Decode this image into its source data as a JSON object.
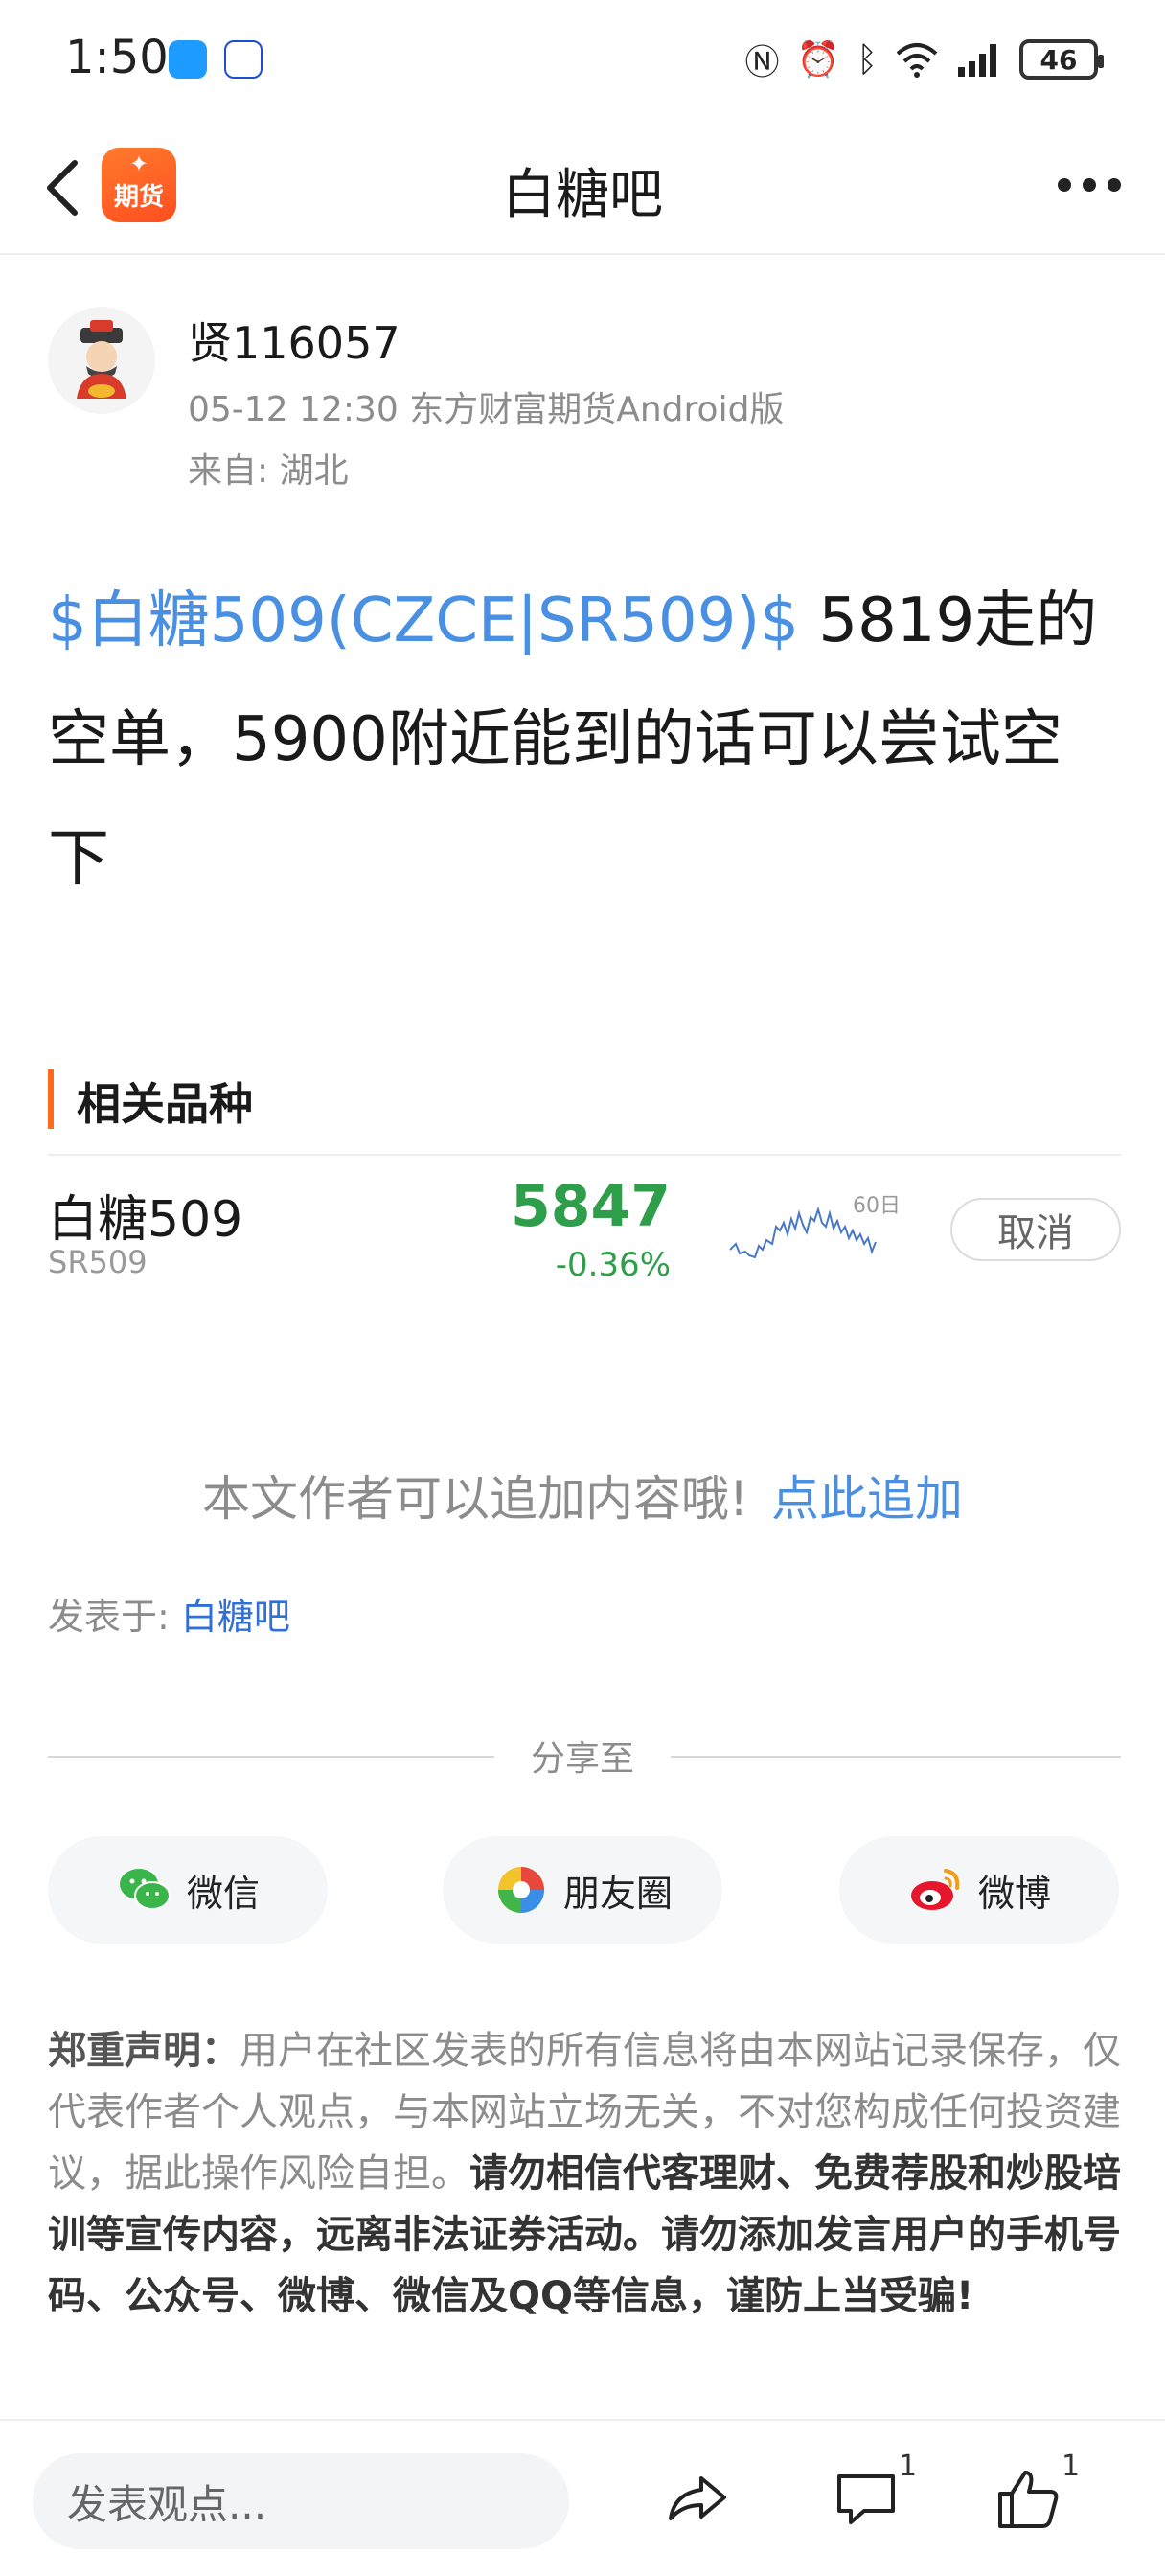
{
  "status_bar": {
    "time": "1:50",
    "battery": "46"
  },
  "header": {
    "title": "白糖吧",
    "logo_text": "期货"
  },
  "post": {
    "author_name": "贤116057",
    "meta": "05-12 12:30 东方财富期货Android版",
    "location": "来自: 湖北",
    "stock_link": "$白糖509(CZCE|SR509)$",
    "body_text": " 5819走的空单，5900附近能到的话可以尝试空下"
  },
  "related": {
    "title": "相关品种",
    "name": "白糖509",
    "code": "SR509",
    "price": "5847",
    "change": "-0.36%",
    "spark_label": "60日",
    "cancel_label": "取消",
    "price_color": "#2e9e4a"
  },
  "append": {
    "text": "本文作者可以追加内容哦!",
    "link": "点此追加"
  },
  "posted_in": {
    "label": "发表于: ",
    "bar": "白糖吧"
  },
  "share": {
    "label": "分享至",
    "wechat": "微信",
    "moments": "朋友圈",
    "weibo": "微博"
  },
  "disclaimer": {
    "title": "郑重声明：",
    "normal": "用户在社区发表的所有信息将由本网站记录保存，仅代表作者个人观点，与本网站立场无关，不对您构成任何投资建议，据此操作风险自担。",
    "strong": "请勿相信代客理财、免费荐股和炒股培训等宣传内容，远离非法证券活动。请勿添加发言用户的手机号码、公众号、微博、微信及QQ等信息，谨防上当受骗!"
  },
  "bottom_bar": {
    "placeholder": "发表观点...",
    "comment_count": "1",
    "like_count": "1"
  },
  "colors": {
    "accent": "#ff6a1f",
    "link": "#4a90e2",
    "down_green": "#2e9e4a"
  }
}
